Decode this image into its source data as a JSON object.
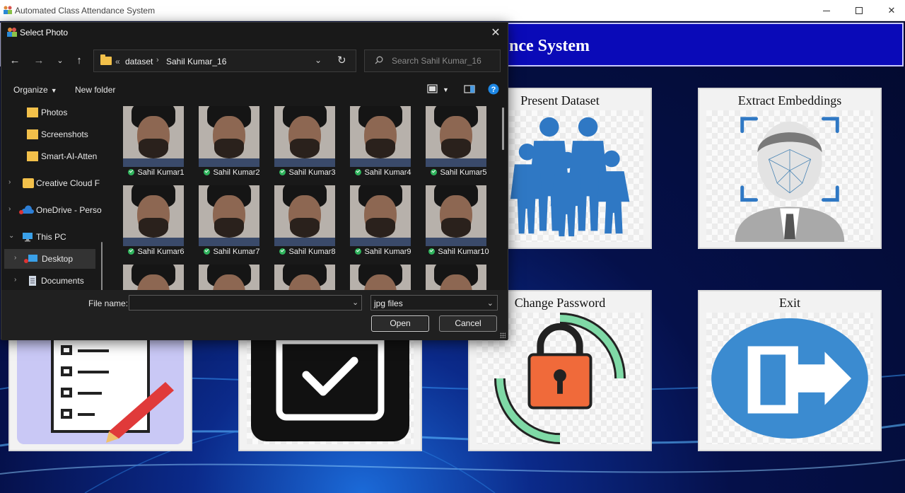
{
  "app": {
    "title": "Automated Class Attendance System",
    "banner_title": "nce System",
    "tiles": [
      {
        "label": "Present Dataset",
        "icon": "people-group-icon"
      },
      {
        "label": "Extract Embeddings",
        "icon": "face-scan-icon"
      },
      {
        "label": "",
        "icon": "checklist-pencil-icon"
      },
      {
        "label": "",
        "icon": "calendar-check-icon"
      },
      {
        "label": "Change Password",
        "icon": "padlock-refresh-icon"
      },
      {
        "label": "Exit",
        "icon": "exit-door-icon"
      }
    ]
  },
  "dialog": {
    "title": "Select Photo",
    "breadcrumb": {
      "overflow": "«",
      "items": [
        "dataset",
        "Sahil Kumar_16"
      ]
    },
    "search_placeholder": "Search Sahil Kumar_16",
    "organize_label": "Organize",
    "new_folder_label": "New folder",
    "nav_items": [
      {
        "label": "Photos",
        "icon": "folder-icon"
      },
      {
        "label": "Screenshots",
        "icon": "folder-icon"
      },
      {
        "label": "Smart-AI-Atten",
        "icon": "folder-icon"
      },
      {
        "label": "Creative Cloud F",
        "icon": "creative-cloud-icon"
      },
      {
        "label": "OneDrive - Perso",
        "icon": "onedrive-icon"
      },
      {
        "label": "This PC",
        "icon": "computer-icon"
      },
      {
        "label": "Desktop",
        "icon": "desktop-icon"
      },
      {
        "label": "Documents",
        "icon": "documents-icon"
      }
    ],
    "files": [
      "Sahil Kumar1",
      "Sahil Kumar2",
      "Sahil Kumar3",
      "Sahil Kumar4",
      "Sahil Kumar5",
      "Sahil Kumar6",
      "Sahil Kumar7",
      "Sahil Kumar8",
      "Sahil Kumar9",
      "Sahil Kumar10"
    ],
    "file_name_label": "File name:",
    "file_name_value": "",
    "file_type": "jpg files",
    "open_label": "Open",
    "cancel_label": "Cancel"
  },
  "colors": {
    "banner": "#0a0ab8",
    "dialog_bg": "#191919",
    "accent": "#0067c0"
  }
}
